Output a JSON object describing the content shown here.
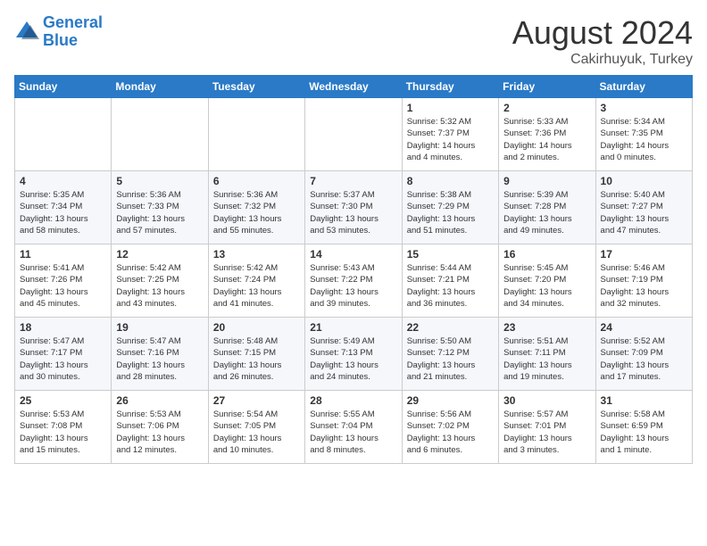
{
  "header": {
    "logo_line1": "General",
    "logo_line2": "Blue",
    "month_year": "August 2024",
    "location": "Cakirhuyuk, Turkey"
  },
  "weekdays": [
    "Sunday",
    "Monday",
    "Tuesday",
    "Wednesday",
    "Thursday",
    "Friday",
    "Saturday"
  ],
  "weeks": [
    [
      {
        "day": "",
        "info": ""
      },
      {
        "day": "",
        "info": ""
      },
      {
        "day": "",
        "info": ""
      },
      {
        "day": "",
        "info": ""
      },
      {
        "day": "1",
        "info": "Sunrise: 5:32 AM\nSunset: 7:37 PM\nDaylight: 14 hours\nand 4 minutes."
      },
      {
        "day": "2",
        "info": "Sunrise: 5:33 AM\nSunset: 7:36 PM\nDaylight: 14 hours\nand 2 minutes."
      },
      {
        "day": "3",
        "info": "Sunrise: 5:34 AM\nSunset: 7:35 PM\nDaylight: 14 hours\nand 0 minutes."
      }
    ],
    [
      {
        "day": "4",
        "info": "Sunrise: 5:35 AM\nSunset: 7:34 PM\nDaylight: 13 hours\nand 58 minutes."
      },
      {
        "day": "5",
        "info": "Sunrise: 5:36 AM\nSunset: 7:33 PM\nDaylight: 13 hours\nand 57 minutes."
      },
      {
        "day": "6",
        "info": "Sunrise: 5:36 AM\nSunset: 7:32 PM\nDaylight: 13 hours\nand 55 minutes."
      },
      {
        "day": "7",
        "info": "Sunrise: 5:37 AM\nSunset: 7:30 PM\nDaylight: 13 hours\nand 53 minutes."
      },
      {
        "day": "8",
        "info": "Sunrise: 5:38 AM\nSunset: 7:29 PM\nDaylight: 13 hours\nand 51 minutes."
      },
      {
        "day": "9",
        "info": "Sunrise: 5:39 AM\nSunset: 7:28 PM\nDaylight: 13 hours\nand 49 minutes."
      },
      {
        "day": "10",
        "info": "Sunrise: 5:40 AM\nSunset: 7:27 PM\nDaylight: 13 hours\nand 47 minutes."
      }
    ],
    [
      {
        "day": "11",
        "info": "Sunrise: 5:41 AM\nSunset: 7:26 PM\nDaylight: 13 hours\nand 45 minutes."
      },
      {
        "day": "12",
        "info": "Sunrise: 5:42 AM\nSunset: 7:25 PM\nDaylight: 13 hours\nand 43 minutes."
      },
      {
        "day": "13",
        "info": "Sunrise: 5:42 AM\nSunset: 7:24 PM\nDaylight: 13 hours\nand 41 minutes."
      },
      {
        "day": "14",
        "info": "Sunrise: 5:43 AM\nSunset: 7:22 PM\nDaylight: 13 hours\nand 39 minutes."
      },
      {
        "day": "15",
        "info": "Sunrise: 5:44 AM\nSunset: 7:21 PM\nDaylight: 13 hours\nand 36 minutes."
      },
      {
        "day": "16",
        "info": "Sunrise: 5:45 AM\nSunset: 7:20 PM\nDaylight: 13 hours\nand 34 minutes."
      },
      {
        "day": "17",
        "info": "Sunrise: 5:46 AM\nSunset: 7:19 PM\nDaylight: 13 hours\nand 32 minutes."
      }
    ],
    [
      {
        "day": "18",
        "info": "Sunrise: 5:47 AM\nSunset: 7:17 PM\nDaylight: 13 hours\nand 30 minutes."
      },
      {
        "day": "19",
        "info": "Sunrise: 5:47 AM\nSunset: 7:16 PM\nDaylight: 13 hours\nand 28 minutes."
      },
      {
        "day": "20",
        "info": "Sunrise: 5:48 AM\nSunset: 7:15 PM\nDaylight: 13 hours\nand 26 minutes."
      },
      {
        "day": "21",
        "info": "Sunrise: 5:49 AM\nSunset: 7:13 PM\nDaylight: 13 hours\nand 24 minutes."
      },
      {
        "day": "22",
        "info": "Sunrise: 5:50 AM\nSunset: 7:12 PM\nDaylight: 13 hours\nand 21 minutes."
      },
      {
        "day": "23",
        "info": "Sunrise: 5:51 AM\nSunset: 7:11 PM\nDaylight: 13 hours\nand 19 minutes."
      },
      {
        "day": "24",
        "info": "Sunrise: 5:52 AM\nSunset: 7:09 PM\nDaylight: 13 hours\nand 17 minutes."
      }
    ],
    [
      {
        "day": "25",
        "info": "Sunrise: 5:53 AM\nSunset: 7:08 PM\nDaylight: 13 hours\nand 15 minutes."
      },
      {
        "day": "26",
        "info": "Sunrise: 5:53 AM\nSunset: 7:06 PM\nDaylight: 13 hours\nand 12 minutes."
      },
      {
        "day": "27",
        "info": "Sunrise: 5:54 AM\nSunset: 7:05 PM\nDaylight: 13 hours\nand 10 minutes."
      },
      {
        "day": "28",
        "info": "Sunrise: 5:55 AM\nSunset: 7:04 PM\nDaylight: 13 hours\nand 8 minutes."
      },
      {
        "day": "29",
        "info": "Sunrise: 5:56 AM\nSunset: 7:02 PM\nDaylight: 13 hours\nand 6 minutes."
      },
      {
        "day": "30",
        "info": "Sunrise: 5:57 AM\nSunset: 7:01 PM\nDaylight: 13 hours\nand 3 minutes."
      },
      {
        "day": "31",
        "info": "Sunrise: 5:58 AM\nSunset: 6:59 PM\nDaylight: 13 hours\nand 1 minute."
      }
    ]
  ]
}
